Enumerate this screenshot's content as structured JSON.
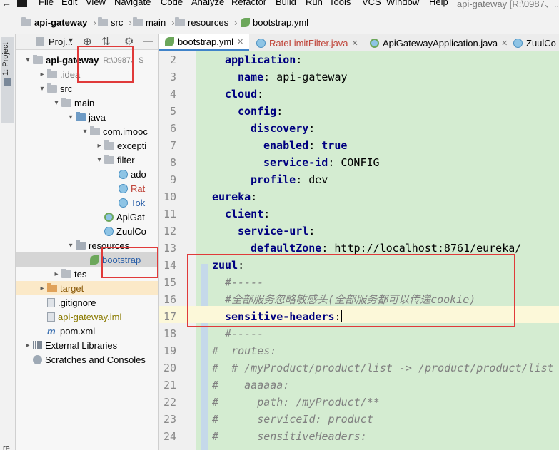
{
  "menu": {
    "items": [
      "File",
      "Edit",
      "View",
      "Navigate",
      "Code",
      "Analyze",
      "Refactor",
      "Build",
      "Run",
      "Tools",
      "VCS",
      "Window",
      "Help"
    ],
    "window_title": "api-gateway [R:\\0987、..."
  },
  "breadcrumb": {
    "items": [
      "api-gateway",
      "src",
      "main",
      "resources",
      "bootstrap.yml"
    ]
  },
  "toolstrip": {
    "project_tab_label": "1: Project",
    "bottom_label": "re"
  },
  "project_panel": {
    "title": "Proj...",
    "buttons": [
      "⊕",
      "⇅",
      "⚙",
      "—"
    ],
    "tree": [
      {
        "label": "api-gateway",
        "hint": "R:\\0987、S",
        "depth": 0,
        "arrow": "▾",
        "icon": "folder",
        "style": "bold"
      },
      {
        "label": ".idea",
        "depth": 1,
        "arrow": "▸",
        "icon": "folder",
        "style": "gray"
      },
      {
        "label": "src",
        "depth": 1,
        "arrow": "▾",
        "icon": "folder"
      },
      {
        "label": "main",
        "depth": 2,
        "arrow": "▾",
        "icon": "folder"
      },
      {
        "label": "java",
        "depth": 3,
        "arrow": "▾",
        "icon": "folder-blue"
      },
      {
        "label": "com.imooc",
        "depth": 4,
        "arrow": "▾",
        "icon": "folder"
      },
      {
        "label": "excepti",
        "depth": 5,
        "arrow": "▸",
        "icon": "folder"
      },
      {
        "label": "filter",
        "depth": 5,
        "arrow": "▾",
        "icon": "folder"
      },
      {
        "label": "ado",
        "depth": 6,
        "arrow": "",
        "icon": "class"
      },
      {
        "label": "Rat",
        "depth": 6,
        "arrow": "",
        "icon": "class",
        "style": "red"
      },
      {
        "label": "Tok",
        "depth": 6,
        "arrow": "",
        "icon": "class",
        "style": "blue"
      },
      {
        "label": "ApiGat",
        "depth": 5,
        "arrow": "",
        "icon": "spring"
      },
      {
        "label": "ZuulCo",
        "depth": 5,
        "arrow": "",
        "icon": "class"
      },
      {
        "label": "resources",
        "depth": 3,
        "arrow": "▾",
        "icon": "folder-res"
      },
      {
        "label": "bootstrap",
        "depth": 4,
        "arrow": "",
        "icon": "yml",
        "style": "blue",
        "selected": true
      },
      {
        "label": "tes",
        "depth": 2,
        "arrow": "▸",
        "icon": "folder"
      },
      {
        "label": "target",
        "depth": 1,
        "arrow": "▸",
        "icon": "folder-orange",
        "style": "brown",
        "target": true
      },
      {
        "label": ".gitignore",
        "depth": 1,
        "arrow": "",
        "icon": "file"
      },
      {
        "label": "api-gateway.iml",
        "depth": 1,
        "arrow": "",
        "icon": "file",
        "style": "olive"
      },
      {
        "label": "pom.xml",
        "depth": 1,
        "arrow": "",
        "icon": "m"
      },
      {
        "label": "External Libraries",
        "depth": 0,
        "arrow": "▸",
        "icon": "lib"
      },
      {
        "label": "Scratches and Consoles",
        "depth": 0,
        "arrow": "",
        "icon": "scratch"
      }
    ]
  },
  "editor": {
    "tabs": [
      {
        "label": "bootstrap.yml",
        "icon": "yml",
        "active": true,
        "closable": true
      },
      {
        "label": "RateLimitFilter.java",
        "icon": "class",
        "active": false,
        "closable": true,
        "style": "red"
      },
      {
        "label": "ApiGatewayApplication.java",
        "icon": "spring",
        "active": false,
        "closable": true
      },
      {
        "label": "ZuulCo",
        "icon": "class",
        "active": false,
        "closable": false
      }
    ],
    "lines": [
      {
        "n": "2",
        "indent": 1,
        "parts": [
          {
            "t": "application",
            "c": "key"
          },
          {
            "t": ":",
            "c": "val"
          }
        ]
      },
      {
        "n": "3",
        "indent": 2,
        "parts": [
          {
            "t": "name",
            "c": "key"
          },
          {
            "t": ": api-gateway",
            "c": "val"
          }
        ]
      },
      {
        "n": "4",
        "indent": 1,
        "parts": [
          {
            "t": "cloud",
            "c": "key"
          },
          {
            "t": ":",
            "c": "val"
          }
        ]
      },
      {
        "n": "5",
        "indent": 2,
        "parts": [
          {
            "t": "config",
            "c": "key"
          },
          {
            "t": ":",
            "c": "val"
          }
        ]
      },
      {
        "n": "6",
        "indent": 3,
        "parts": [
          {
            "t": "discovery",
            "c": "key"
          },
          {
            "t": ":",
            "c": "val"
          }
        ]
      },
      {
        "n": "7",
        "indent": 4,
        "parts": [
          {
            "t": "enabled",
            "c": "key"
          },
          {
            "t": ": ",
            "c": "val"
          },
          {
            "t": "true",
            "c": "kw"
          }
        ]
      },
      {
        "n": "8",
        "indent": 4,
        "parts": [
          {
            "t": "service-id",
            "c": "key"
          },
          {
            "t": ": CONFIG",
            "c": "val"
          }
        ]
      },
      {
        "n": "9",
        "indent": 3,
        "parts": [
          {
            "t": "profile",
            "c": "key"
          },
          {
            "t": ": dev",
            "c": "val"
          }
        ]
      },
      {
        "n": "10",
        "indent": 0,
        "parts": [
          {
            "t": "eureka",
            "c": "key"
          },
          {
            "t": ":",
            "c": "val"
          }
        ]
      },
      {
        "n": "11",
        "indent": 1,
        "parts": [
          {
            "t": "client",
            "c": "key"
          },
          {
            "t": ":",
            "c": "val"
          }
        ]
      },
      {
        "n": "12",
        "indent": 2,
        "parts": [
          {
            "t": "service-url",
            "c": "key"
          },
          {
            "t": ":",
            "c": "val"
          }
        ]
      },
      {
        "n": "13",
        "indent": 3,
        "parts": [
          {
            "t": "defaultZone",
            "c": "key"
          },
          {
            "t": ": http://localhost:8761/eureka/",
            "c": "url"
          }
        ]
      },
      {
        "n": "14",
        "indent": 0,
        "parts": [
          {
            "t": "zuul",
            "c": "key"
          },
          {
            "t": ":",
            "c": "val"
          }
        ]
      },
      {
        "n": "15",
        "indent": 1,
        "parts": [
          {
            "t": "#-----",
            "c": "cmt"
          }
        ]
      },
      {
        "n": "16",
        "indent": 1,
        "parts": [
          {
            "t": "#全部服务忽略敏感头(全部服务都可以传递cookie)",
            "c": "cmt"
          }
        ]
      },
      {
        "n": "17",
        "indent": 1,
        "parts": [
          {
            "t": "sensitive-headers",
            "c": "key"
          },
          {
            "t": ":",
            "c": "val"
          }
        ],
        "caret": true
      },
      {
        "n": "18",
        "indent": 1,
        "parts": [
          {
            "t": "#-----",
            "c": "cmt"
          }
        ]
      },
      {
        "n": "19",
        "indent": 0,
        "parts": [
          {
            "t": "#  routes:",
            "c": "cmt"
          }
        ]
      },
      {
        "n": "20",
        "indent": 0,
        "parts": [
          {
            "t": "#  # /myProduct/product/list -> /product/product/list",
            "c": "cmt"
          }
        ]
      },
      {
        "n": "21",
        "indent": 0,
        "parts": [
          {
            "t": "#    aaaaaa:",
            "c": "cmt"
          }
        ]
      },
      {
        "n": "22",
        "indent": 0,
        "parts": [
          {
            "t": "#      path: /myProduct/**",
            "c": "cmt"
          }
        ]
      },
      {
        "n": "23",
        "indent": 0,
        "parts": [
          {
            "t": "#      serviceId: product",
            "c": "cmt"
          }
        ]
      },
      {
        "n": "24",
        "indent": 0,
        "parts": [
          {
            "t": "#      sensitiveHeaders:",
            "c": "cmt"
          }
        ]
      }
    ]
  },
  "colors": {
    "code_bg": "#d4ecd1",
    "key": "#000080",
    "comment": "#808080",
    "annotation": "#e03a3a",
    "selection": "#d5d5d5",
    "caret_line": "#fcf8d9"
  }
}
